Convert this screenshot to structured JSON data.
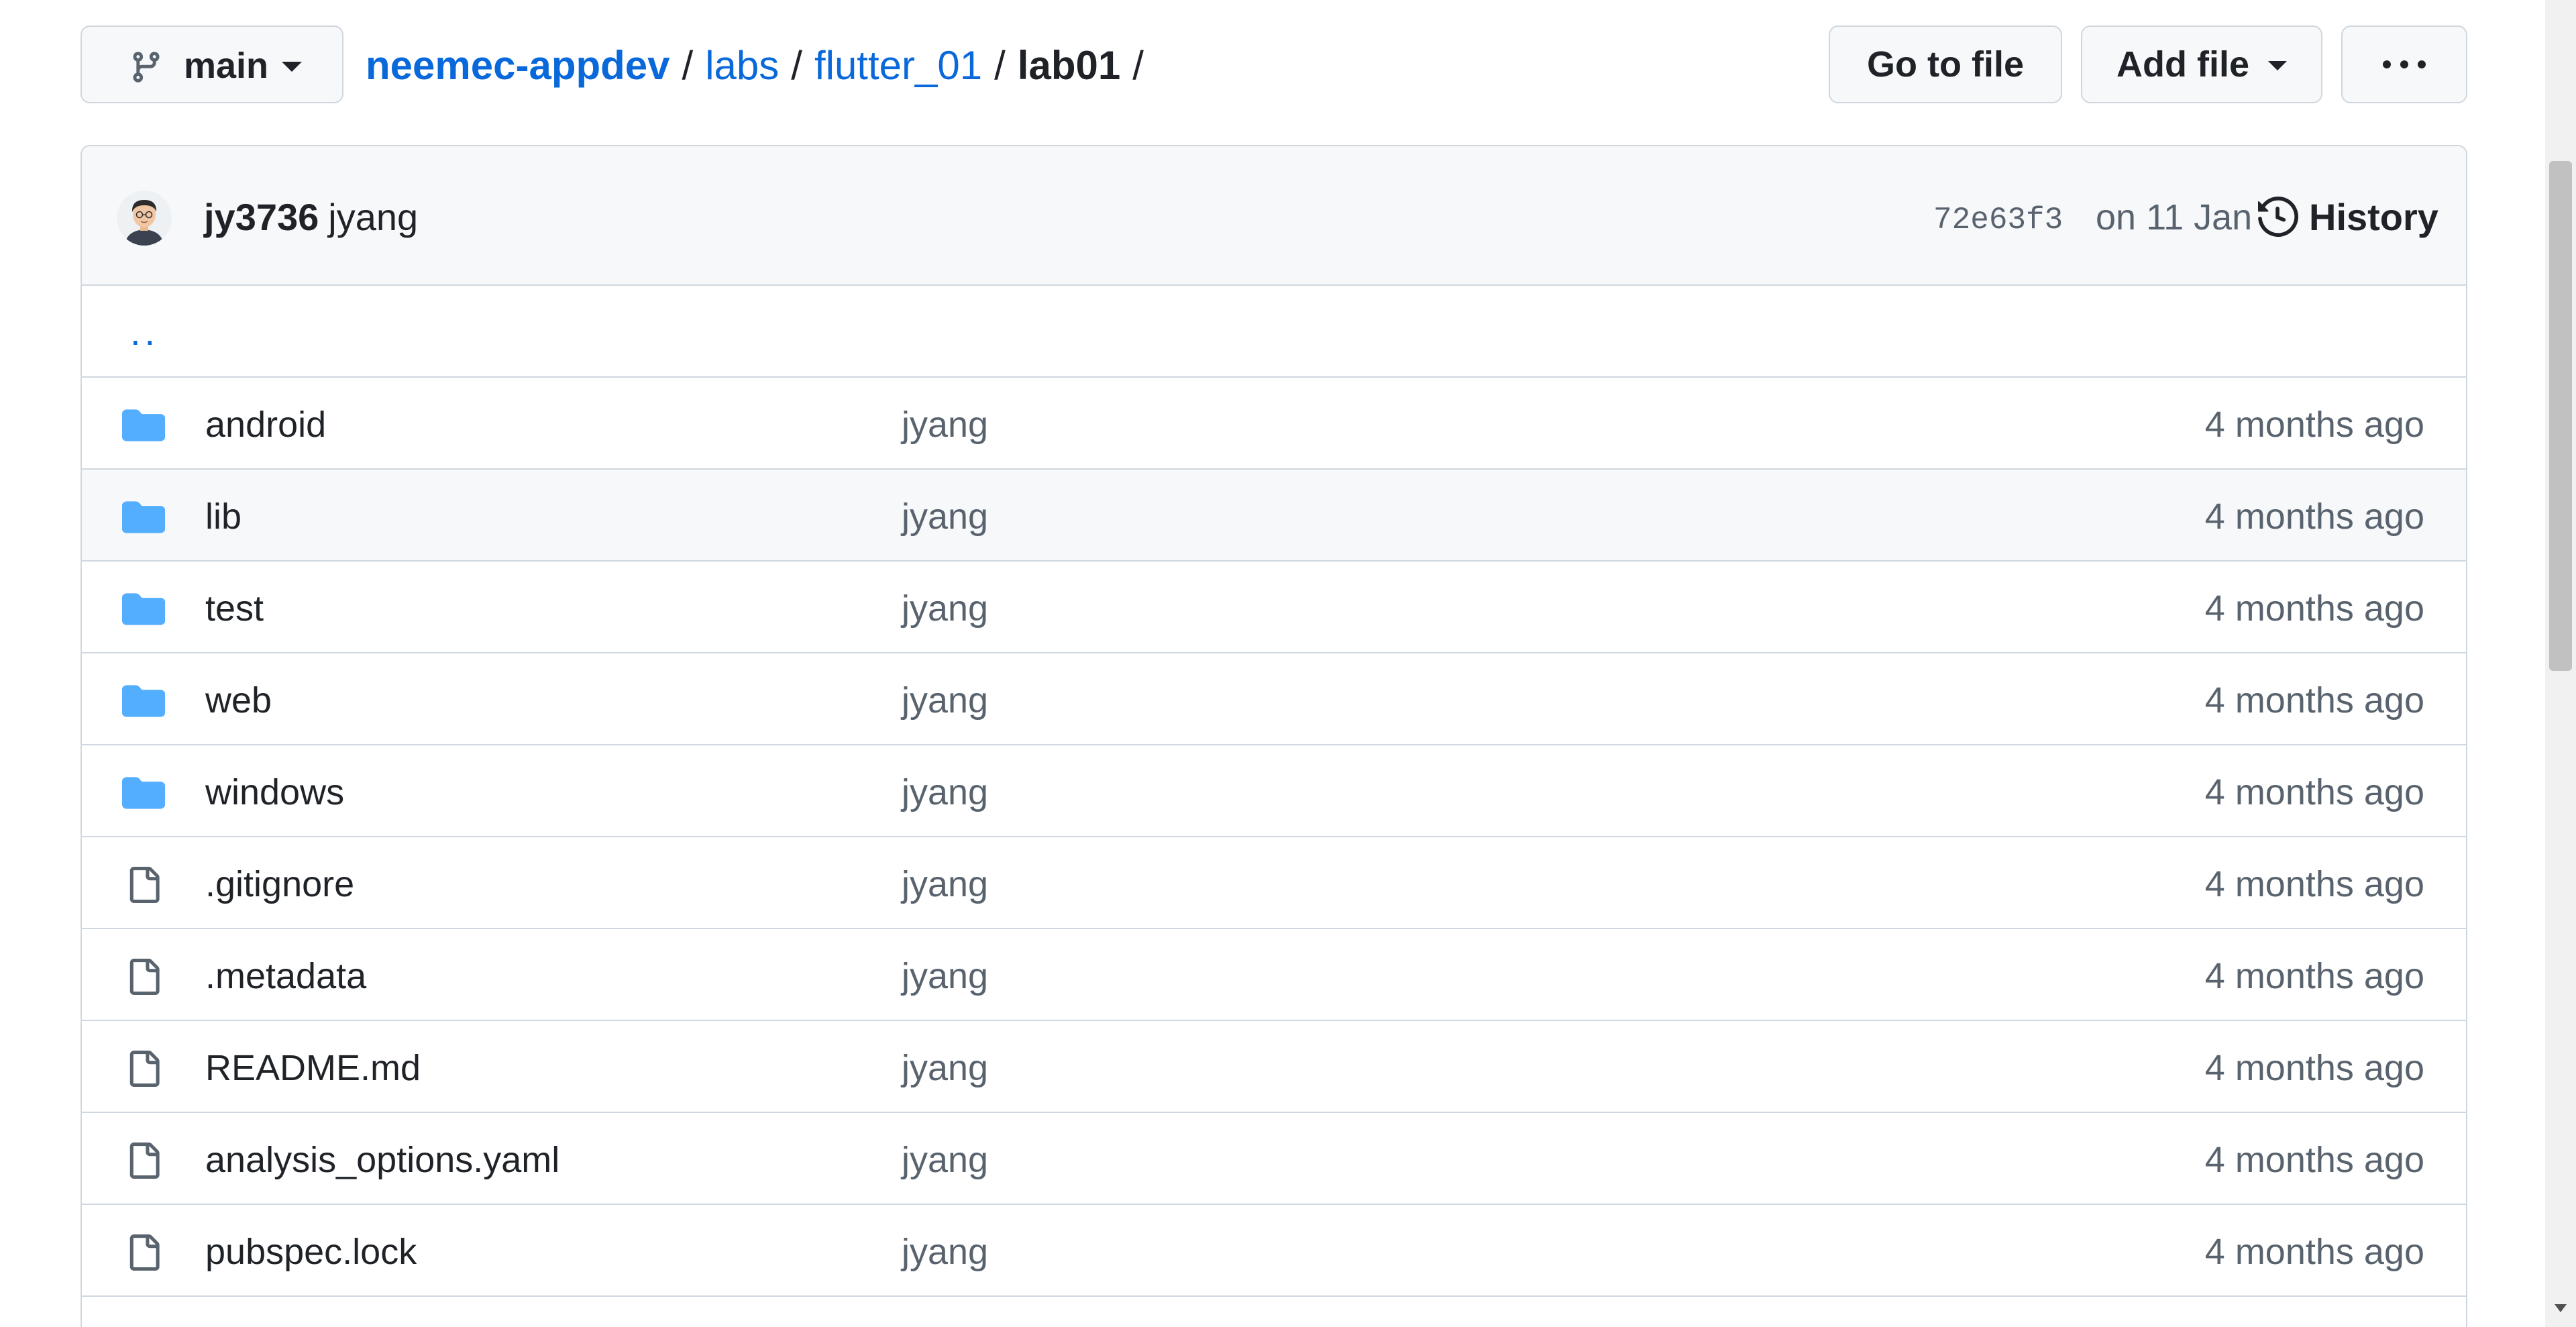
{
  "branch": {
    "name": "main"
  },
  "breadcrumb": {
    "repo": "neemec-appdev",
    "separator": "/",
    "links": [
      "labs",
      "flutter_01"
    ],
    "current": "lab01",
    "trailing": "/"
  },
  "toolbar": {
    "go_to_file": "Go to file",
    "add_file": "Add file",
    "more_icon": "kebab-horizontal-icon"
  },
  "latest_commit": {
    "author_login": "jy3736",
    "message": "jyang",
    "sha": "72e63f3",
    "date": "on 11 Jan",
    "history_label": "History"
  },
  "parent_dir": "..",
  "files": [
    {
      "type": "dir",
      "icon": "folder-icon",
      "name": "android",
      "commit": "jyang",
      "age": "4 months ago"
    },
    {
      "type": "dir",
      "icon": "folder-icon",
      "name": "lib",
      "commit": "jyang",
      "age": "4 months ago"
    },
    {
      "type": "dir",
      "icon": "folder-icon",
      "name": "test",
      "commit": "jyang",
      "age": "4 months ago"
    },
    {
      "type": "dir",
      "icon": "folder-icon",
      "name": "web",
      "commit": "jyang",
      "age": "4 months ago"
    },
    {
      "type": "dir",
      "icon": "folder-icon",
      "name": "windows",
      "commit": "jyang",
      "age": "4 months ago"
    },
    {
      "type": "file",
      "icon": "file-icon",
      "name": ".gitignore",
      "commit": "jyang",
      "age": "4 months ago"
    },
    {
      "type": "file",
      "icon": "file-icon",
      "name": ".metadata",
      "commit": "jyang",
      "age": "4 months ago"
    },
    {
      "type": "file",
      "icon": "file-icon",
      "name": "README.md",
      "commit": "jyang",
      "age": "4 months ago"
    },
    {
      "type": "file",
      "icon": "file-icon",
      "name": "analysis_options.yaml",
      "commit": "jyang",
      "age": "4 months ago"
    },
    {
      "type": "file",
      "icon": "file-icon",
      "name": "pubspec.lock",
      "commit": "jyang",
      "age": "4 months ago"
    }
  ],
  "colors": {
    "link": "#0969da",
    "folder": "#54aeff",
    "muted_text": "#59636e",
    "border": "#d0d7de",
    "header_bg": "#f6f8fa"
  }
}
